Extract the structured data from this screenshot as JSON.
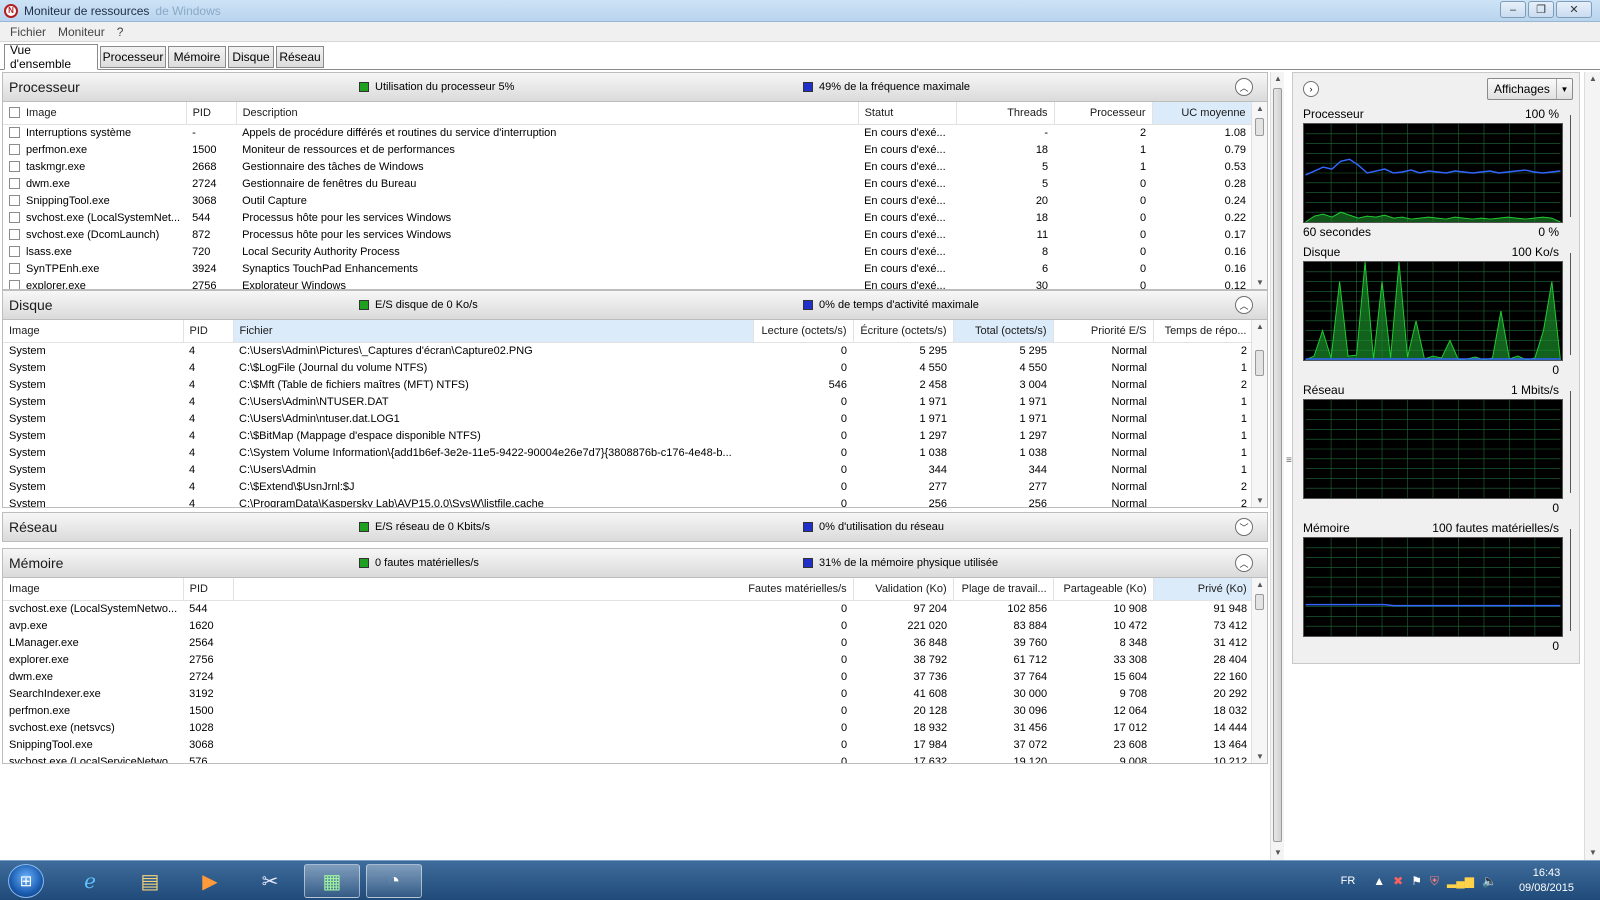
{
  "window": {
    "title": "Moniteur de ressources",
    "title_suffix": "de Windows",
    "controls": {
      "minimize": "–",
      "maximize": "❐",
      "close": "✕"
    }
  },
  "menu": [
    "Fichier",
    "Moniteur",
    "?"
  ],
  "tabs": [
    {
      "label": "Vue d'ensemble",
      "active": true
    },
    {
      "label": "Processeur"
    },
    {
      "label": "Mémoire"
    },
    {
      "label": "Disque"
    },
    {
      "label": "Réseau"
    }
  ],
  "cpu": {
    "title": "Processeur",
    "stat1": "Utilisation du processeur 5%",
    "stat2": "49% de la fréquence maximale",
    "headers": [
      "Image",
      "PID",
      "Description",
      "Statut",
      "Threads",
      "Processeur",
      "UC moyenne"
    ],
    "rows": [
      [
        "Interruptions système",
        "-",
        "Appels de procédure différés et routines du service d'interruption",
        "En cours d'exé...",
        "-",
        "2",
        "1.08"
      ],
      [
        "perfmon.exe",
        "1500",
        "Moniteur de ressources et de performances",
        "En cours d'exé...",
        "18",
        "1",
        "0.79"
      ],
      [
        "taskmgr.exe",
        "2668",
        "Gestionnaire des tâches de Windows",
        "En cours d'exé...",
        "5",
        "1",
        "0.53"
      ],
      [
        "dwm.exe",
        "2724",
        "Gestionnaire de fenêtres du Bureau",
        "En cours d'exé...",
        "5",
        "0",
        "0.28"
      ],
      [
        "SnippingTool.exe",
        "3068",
        "Outil Capture",
        "En cours d'exé...",
        "20",
        "0",
        "0.24"
      ],
      [
        "svchost.exe (LocalSystemNet...",
        "544",
        "Processus hôte pour les services Windows",
        "En cours d'exé...",
        "18",
        "0",
        "0.22"
      ],
      [
        "svchost.exe (DcomLaunch)",
        "872",
        "Processus hôte pour les services Windows",
        "En cours d'exé...",
        "11",
        "0",
        "0.17"
      ],
      [
        "lsass.exe",
        "720",
        "Local Security Authority Process",
        "En cours d'exé...",
        "8",
        "0",
        "0.16"
      ],
      [
        "SynTPEnh.exe",
        "3924",
        "Synaptics TouchPad Enhancements",
        "En cours d'exé...",
        "6",
        "0",
        "0.16"
      ],
      [
        "explorer.exe",
        "2756",
        "Explorateur Windows",
        "En cours d'exé...",
        "30",
        "0",
        "0.12"
      ]
    ]
  },
  "disk": {
    "title": "Disque",
    "stat1": "E/S disque de 0 Ko/s",
    "stat2": "0% de temps d'activité maximale",
    "headers": [
      "Image",
      "PID",
      "Fichier",
      "Lecture (octets/s)",
      "Écriture (octets/s)",
      "Total (octets/s)",
      "Priorité E/S",
      "Temps de répo..."
    ],
    "rows": [
      [
        "System",
        "4",
        "C:\\Users\\Admin\\Pictures\\_Captures d'écran\\Capture02.PNG",
        "0",
        "5 295",
        "5 295",
        "Normal",
        "2"
      ],
      [
        "System",
        "4",
        "C:\\$LogFile (Journal du volume NTFS)",
        "0",
        "4 550",
        "4 550",
        "Normal",
        "1"
      ],
      [
        "System",
        "4",
        "C:\\$Mft (Table de fichiers maîtres (MFT) NTFS)",
        "546",
        "2 458",
        "3 004",
        "Normal",
        "2"
      ],
      [
        "System",
        "4",
        "C:\\Users\\Admin\\NTUSER.DAT",
        "0",
        "1 971",
        "1 971",
        "Normal",
        "1"
      ],
      [
        "System",
        "4",
        "C:\\Users\\Admin\\ntuser.dat.LOG1",
        "0",
        "1 971",
        "1 971",
        "Normal",
        "1"
      ],
      [
        "System",
        "4",
        "C:\\$BitMap (Mappage d'espace disponible NTFS)",
        "0",
        "1 297",
        "1 297",
        "Normal",
        "1"
      ],
      [
        "System",
        "4",
        "C:\\System Volume Information\\{add1b6ef-3e2e-11e5-9422-90004e26e7d7}{3808876b-c176-4e48-b...",
        "0",
        "1 038",
        "1 038",
        "Normal",
        "1"
      ],
      [
        "System",
        "4",
        "C:\\Users\\Admin",
        "0",
        "344",
        "344",
        "Normal",
        "1"
      ],
      [
        "System",
        "4",
        "C:\\$Extend\\$UsnJrnl:$J",
        "0",
        "277",
        "277",
        "Normal",
        "2"
      ],
      [
        "System",
        "4",
        "C:\\ProgramData\\Kaspersky Lab\\AVP15.0.0\\SysW\\listfile.cache",
        "0",
        "256",
        "256",
        "Normal",
        "2"
      ]
    ]
  },
  "network": {
    "title": "Réseau",
    "stat1": "E/S réseau de 0 Kbits/s",
    "stat2": "0% d'utilisation du réseau"
  },
  "memory": {
    "title": "Mémoire",
    "stat1": "0 fautes matérielles/s",
    "stat2": "31% de la mémoire physique utilisée",
    "headers": [
      "Image",
      "PID",
      "Fautes matérielles/s",
      "Validation (Ko)",
      "Plage de travail...",
      "Partageable (Ko)",
      "Privé (Ko)"
    ],
    "rows": [
      [
        "svchost.exe (LocalSystemNetwo...",
        "544",
        "0",
        "97 204",
        "102 856",
        "10 908",
        "91 948"
      ],
      [
        "avp.exe",
        "1620",
        "0",
        "221 020",
        "83 884",
        "10 472",
        "73 412"
      ],
      [
        "LManager.exe",
        "2564",
        "0",
        "36 848",
        "39 760",
        "8 348",
        "31 412"
      ],
      [
        "explorer.exe",
        "2756",
        "0",
        "38 792",
        "61 712",
        "33 308",
        "28 404"
      ],
      [
        "dwm.exe",
        "2724",
        "0",
        "37 736",
        "37 764",
        "15 604",
        "22 160"
      ],
      [
        "SearchIndexer.exe",
        "3192",
        "0",
        "41 608",
        "30 000",
        "9 708",
        "20 292"
      ],
      [
        "perfmon.exe",
        "1500",
        "0",
        "20 128",
        "30 096",
        "12 064",
        "18 032"
      ],
      [
        "svchost.exe (netsvcs)",
        "1028",
        "0",
        "18 932",
        "31 456",
        "17 012",
        "14 444"
      ],
      [
        "SnippingTool.exe",
        "3068",
        "0",
        "17 984",
        "37 072",
        "23 608",
        "13 464"
      ],
      [
        "svchost.exe (LocalServiceNetwo...",
        "576",
        "0",
        "17 632",
        "19 120",
        "9 008",
        "10 212"
      ]
    ]
  },
  "right_panel": {
    "views_label": "Affichages",
    "graphs": [
      {
        "label": "Processeur",
        "max": "100 %",
        "bottom_left": "60 secondes",
        "bottom_right": "0 %"
      },
      {
        "label": "Disque",
        "max": "100 Ko/s",
        "bottom_left": "",
        "bottom_right": "0"
      },
      {
        "label": "Réseau",
        "max": "1 Mbits/s",
        "bottom_left": "",
        "bottom_right": "0"
      },
      {
        "label": "Mémoire",
        "max": "100 fautes matérielles/s",
        "bottom_left": "",
        "bottom_right": "0"
      }
    ]
  },
  "colors": {
    "green": "#20a020",
    "blue": "#2030c8",
    "graph_bg": "#000000",
    "graph_grid": "#1f6b3a",
    "green_line": "#22cc33",
    "blue_line": "#3366ff"
  },
  "taskbar": {
    "lang": "FR",
    "time": "16:43",
    "date": "09/08/2015",
    "icons": [
      "windows-start-icon",
      "internet-explorer-icon",
      "file-explorer-icon",
      "media-player-icon",
      "snipping-tool-icon",
      "performance-monitor-icon",
      "resource-monitor-icon"
    ]
  }
}
